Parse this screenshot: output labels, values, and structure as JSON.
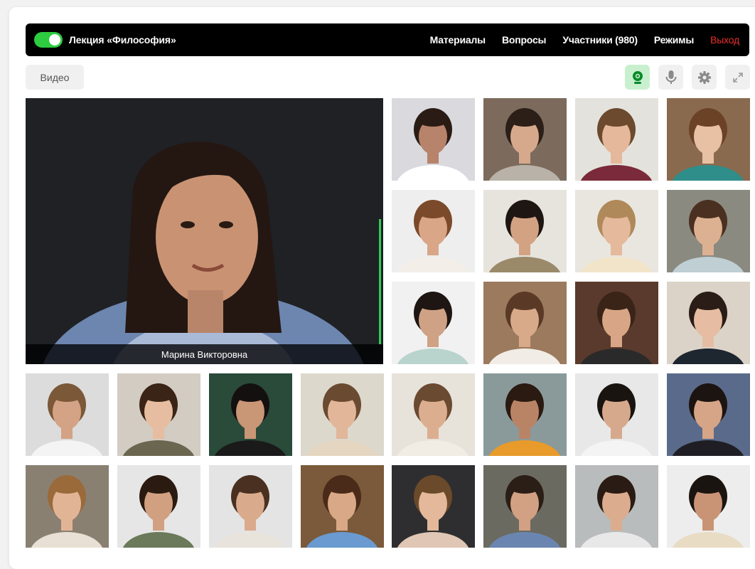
{
  "header": {
    "lecture_title": "Лекция «Философия»",
    "nav": {
      "materials": "Материалы",
      "questions": "Вопросы",
      "participants": "Участники (980)",
      "modes": "Режимы",
      "exit": "Выход"
    },
    "toggle_on": true
  },
  "toolbar": {
    "video_tab": "Видео",
    "icons": [
      "webcam-icon",
      "microphone-icon",
      "gear-icon",
      "fullscreen-icon"
    ]
  },
  "colors": {
    "accent_green": "#2ecc40",
    "exit_red": "#e8312f",
    "camera_active_bg": "#c8f0cf"
  },
  "speaker": {
    "name": "Марина Викторовна"
  },
  "participants": [
    {
      "bg": "#d9d9de",
      "shirt": "#ffffff",
      "hair": "#2a1c14",
      "skin": "#b7836a"
    },
    {
      "bg": "#7c6a5c",
      "shirt": "#b9b2a8",
      "hair": "#2b1f18",
      "skin": "#d6a98c"
    },
    {
      "bg": "#e4e2dc",
      "shirt": "#7a2a3a",
      "hair": "#6b4a2e",
      "skin": "#e5b89b"
    },
    {
      "bg": "#8a6a4e",
      "shirt": "#2f8e8a",
      "hair": "#6b4226",
      "skin": "#e8c0a4"
    },
    {
      "bg": "#eeeeee",
      "shirt": "#f3efe8",
      "hair": "#7a4a2a",
      "skin": "#d9a688"
    },
    {
      "bg": "#e7e4de",
      "shirt": "#9a8a6a",
      "hair": "#1e1612",
      "skin": "#d3a283"
    },
    {
      "bg": "#e9e6e0",
      "shirt": "#f2e4c8",
      "hair": "#b0895a",
      "skin": "#e4b99c"
    },
    {
      "bg": "#8a8a80",
      "shirt": "#bfcfd4",
      "hair": "#4a3020",
      "skin": "#dcb192"
    },
    {
      "bg": "#f1f1f1",
      "shirt": "#b9d4cc",
      "hair": "#1e1612",
      "skin": "#cfa185"
    },
    {
      "bg": "#9c7a5e",
      "shirt": "#f1ede6",
      "hair": "#5a3a26",
      "skin": "#d9aa8a"
    },
    {
      "bg": "#5a3a2c",
      "shirt": "#2a2a2a",
      "hair": "#3a2418",
      "skin": "#d8a686"
    },
    {
      "bg": "#dcd3c8",
      "shirt": "#1e2630",
      "hair": "#2a1c16",
      "skin": "#e6bda2"
    },
    {
      "bg": "#dcdcdc",
      "shirt": "#f4f4f4",
      "hair": "#7a5838",
      "skin": "#d4a284"
    },
    {
      "bg": "#d2ccc2",
      "shirt": "#6a6650",
      "hair": "#3a2416",
      "skin": "#e6bda0"
    },
    {
      "bg": "#2a4a3a",
      "shirt": "#1a1a1a",
      "hair": "#141010",
      "skin": "#c99676"
    },
    {
      "bg": "#ddd8cc",
      "shirt": "#e4d6c0",
      "hair": "#6a4a30",
      "skin": "#e1b699"
    },
    {
      "bg": "#e7e2da",
      "shirt": "#f1ece4",
      "hair": "#6a4a30",
      "skin": "#dcae90"
    },
    {
      "bg": "#8a9a9a",
      "shirt": "#e89a2a",
      "hair": "#2a1a12",
      "skin": "#b98466"
    },
    {
      "bg": "#e8e8e8",
      "shirt": "#f4f4f4",
      "hair": "#1a1410",
      "skin": "#d7a98c"
    },
    {
      "bg": "#5a6a8a",
      "shirt": "#1e1e24",
      "hair": "#1c1410",
      "skin": "#d6a486"
    },
    {
      "bg": "#8a8072",
      "shirt": "#e8e0d4",
      "hair": "#9a6a3a",
      "skin": "#e2b496"
    },
    {
      "bg": "#e6e6e6",
      "shirt": "#6a7a5a",
      "hair": "#2a1a10",
      "skin": "#d1a081"
    },
    {
      "bg": "#e4e4e4",
      "shirt": "#e8e4dc",
      "hair": "#4a3020",
      "skin": "#d9ab8c"
    },
    {
      "bg": "#7a5a3a",
      "shirt": "#6a9ad0",
      "hair": "#4a2a18",
      "skin": "#d9a886"
    },
    {
      "bg": "#2e2e30",
      "shirt": "#e0c6b4",
      "hair": "#6a4a2a",
      "skin": "#e4b89a"
    },
    {
      "bg": "#6a6a60",
      "shirt": "#6a86b0",
      "hair": "#2a1e16",
      "skin": "#d2a082"
    },
    {
      "bg": "#b8bcbc",
      "shirt": "#e8e8e8",
      "hair": "#2a1c14",
      "skin": "#dcac8e"
    },
    {
      "bg": "#ededed",
      "shirt": "#e8dcc4",
      "hair": "#1a1410",
      "skin": "#c99476"
    }
  ]
}
